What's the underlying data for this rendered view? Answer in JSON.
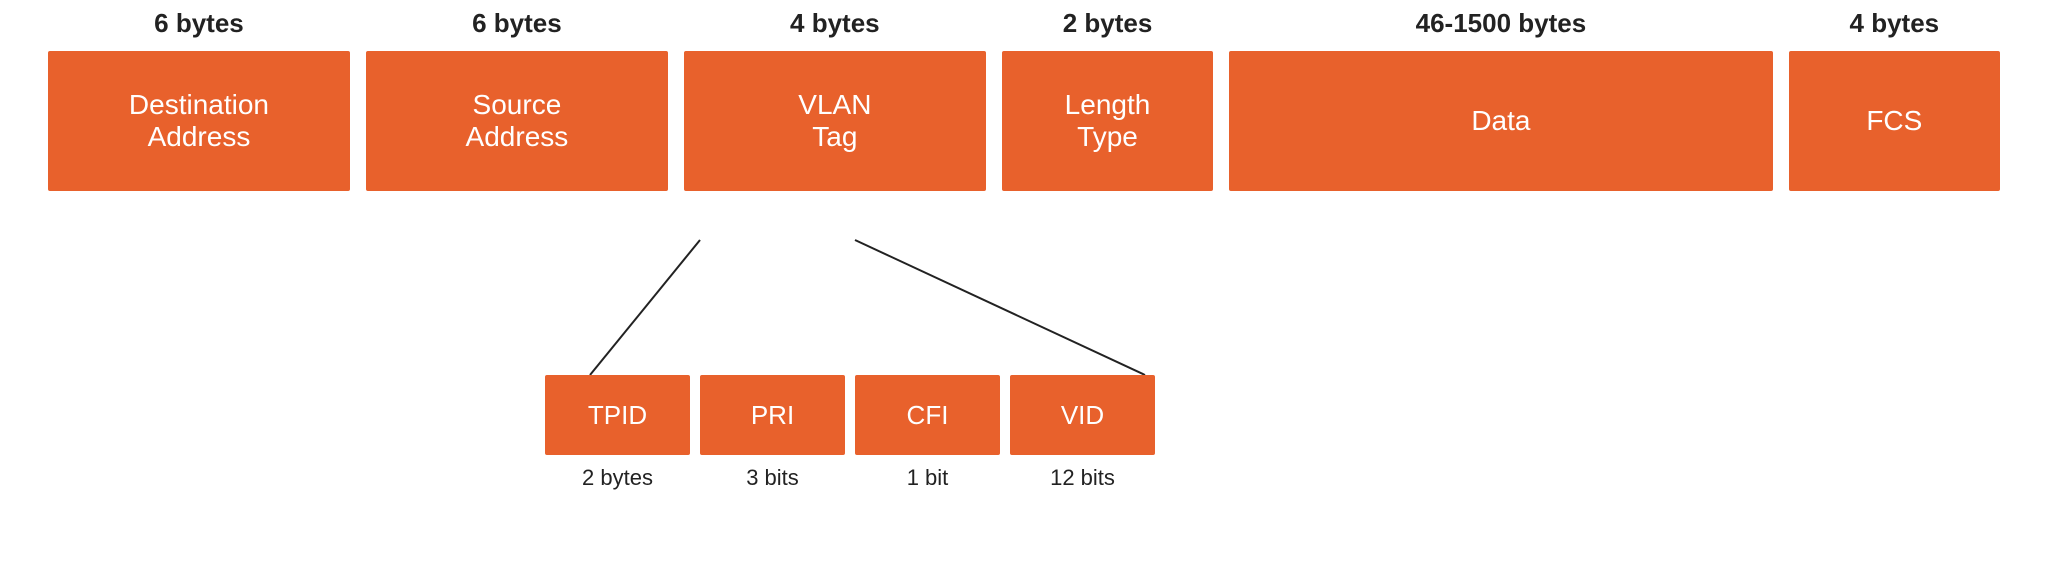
{
  "fields": [
    {
      "id": "destination",
      "bytes": "6 bytes",
      "label": "Destination\nAddress"
    },
    {
      "id": "source",
      "bytes": "6 bytes",
      "label": "Source\nAddress"
    },
    {
      "id": "vlan",
      "bytes": "4 bytes",
      "label": "VLAN\nTag"
    },
    {
      "id": "length-type",
      "bytes": "2 bytes",
      "label": "Length\nType"
    },
    {
      "id": "data",
      "bytes": "46-1500 bytes",
      "label": "Data"
    },
    {
      "id": "fcs",
      "bytes": "4 bytes",
      "label": "FCS"
    }
  ],
  "subfields": [
    {
      "id": "tpid",
      "label": "TPID",
      "sublabel": "2 bytes"
    },
    {
      "id": "pri",
      "label": "PRI",
      "sublabel": "3 bits"
    },
    {
      "id": "cfi",
      "label": "CFI",
      "sublabel": "1 bit"
    },
    {
      "id": "vid",
      "label": "VID",
      "sublabel": "12 bits"
    }
  ],
  "colors": {
    "box": "#E8612C",
    "text_dark": "#222222",
    "text_light": "#ffffff"
  }
}
